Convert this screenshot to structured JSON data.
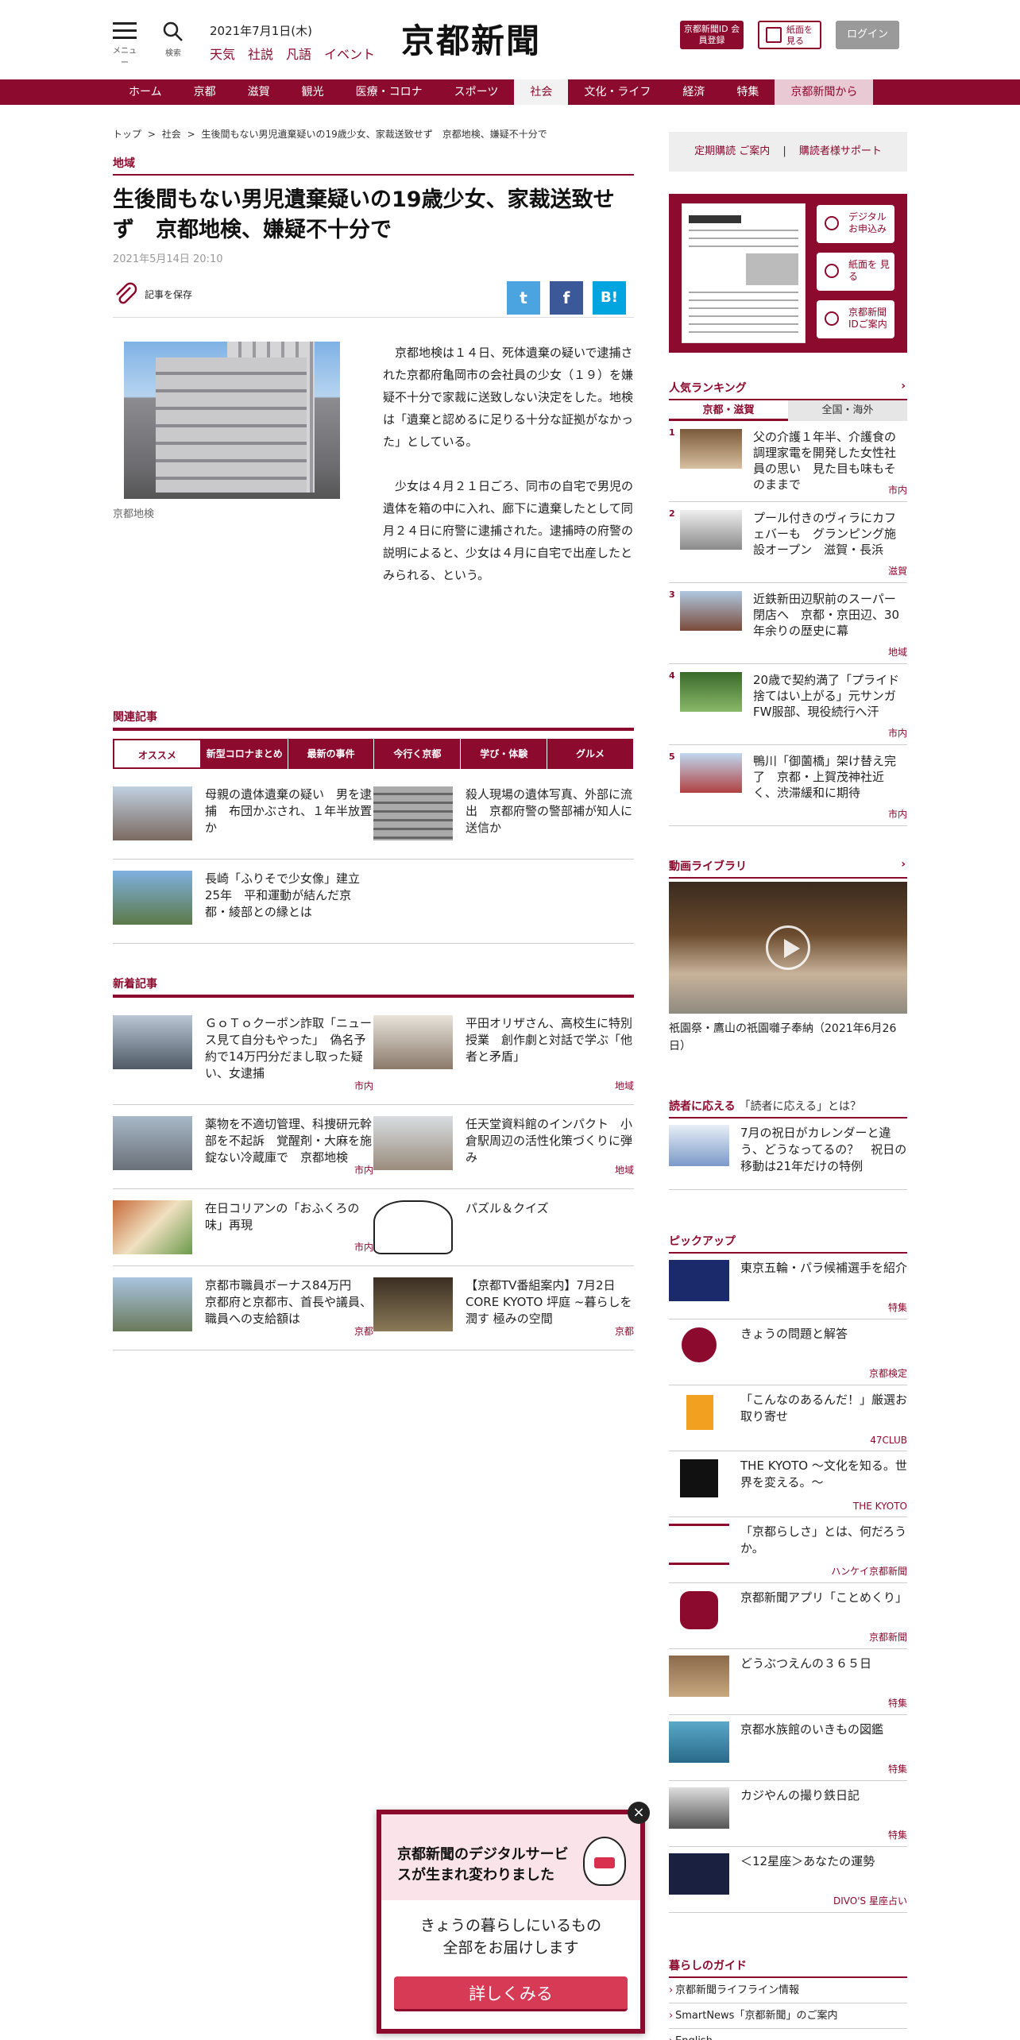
{
  "header": {
    "menu_label": "メニュー",
    "search_label": "検索",
    "date": "2021年7月1日(木)",
    "quick_links": [
      "天気",
      "社説",
      "凡語",
      "イベント"
    ],
    "logo": "京都新聞",
    "id_button": "京都新聞ID 会員登録",
    "paper_button": "紙面を見る",
    "login_button": "ログイン"
  },
  "nav": [
    "ホーム",
    "京都",
    "滋賀",
    "観光",
    "医療・コロナ",
    "スポーツ",
    "社会",
    "文化・ライフ",
    "経済",
    "特集",
    "京都新聞から"
  ],
  "breadcrumb": [
    "トップ",
    ">",
    "社会",
    ">",
    "生後間もない男児遺棄疑いの19歳少女、家裁送致せず　京都地検、嫌疑不十分で"
  ],
  "article": {
    "category": "地域",
    "title": "生後間もない男児遺棄疑いの19歳少女、家裁送致せず　京都地検、嫌疑不十分で",
    "date": "2021年5月14日 20:10",
    "save_label": "記事を保存",
    "share": {
      "twitter": "t",
      "facebook": "f",
      "hatena": "B!"
    },
    "photo_caption": "京都地検",
    "paragraphs": [
      "京都地検は１４日、死体遺棄の疑いで逮捕された京都府亀岡市の会社員の少女（１９）を嫌疑不十分で家裁に送致しない決定をした。地検は「遺棄と認めるに足りる十分な証拠がなかった」としている。",
      "少女は４月２１日ごろ、同市の自宅で男児の遺体を箱の中に入れ、廊下に遺棄したとして同月２４日に府警に逮捕された。逮捕時の府警の説明によると、少女は４月に自宅で出産したとみられる、という。"
    ]
  },
  "related": {
    "title": "関連記事",
    "tabs": [
      "オススメ",
      "新型コロナまとめ",
      "最新の事件",
      "今行く京都",
      "学び・体験",
      "グルメ"
    ],
    "items": [
      {
        "text": "母親の遺体遺棄の疑い　男を逮捕　布団かぶされ、１年半放置か"
      },
      {
        "text": "殺人現場の遺体写真、外部に流出　京都府警の警部補が知人に送信か"
      },
      {
        "text": "長崎「ふりそで少女像」建立25年　平和運動が結んだ京都・綾部との縁とは"
      }
    ]
  },
  "newest": {
    "title": "新着記事",
    "items": [
      {
        "text": "ＧｏＴｏクーポン詐取「ニュース見て自分もやった」　偽名予約で14万円分だまし取った疑い、女逮捕",
        "tag": "市内"
      },
      {
        "text": "平田オリザさん、高校生に特別授業　創作劇と対話で学ぶ「他者と矛盾」",
        "tag": "地域"
      },
      {
        "text": "薬物を不適切管理、科捜研元幹部を不起訴　覚醒剤・大麻を施錠ない冷蔵庫で　京都地検",
        "tag": "市内"
      },
      {
        "text": "任天堂資料館のインパクト　小倉駅周辺の活性化策づくりに弾み",
        "tag": "地域"
      },
      {
        "text": "在日コリアンの「おふくろの味」再現",
        "tag": "市内"
      },
      {
        "text": "パズル＆クイズ",
        "tag": ""
      },
      {
        "text": "京都市職員ボーナス84万円　京都府と京都市、首長や議員、職員への支給額は",
        "tag": "京都"
      },
      {
        "text": "【京都TV番組案内】7月2日　CORE KYOTO 坪庭 ~暮らしを潤す 極みの空間",
        "tag": "京都"
      }
    ]
  },
  "sidebar": {
    "sub_links": [
      "定期購読 ご案内",
      "|",
      "購読者様サポート"
    ],
    "paper_buttons": [
      "デジタル お申込み",
      "紙面を 見る",
      "京都新聞 IDご案内"
    ],
    "ranking_title": "人気ランキング",
    "ranking_tabs": [
      "京都・滋賀",
      "全国・海外"
    ],
    "ranking": [
      {
        "no": "1",
        "text": "父の介護１年半、介護食の調理家電を開発した女性社員の思い　見た目も味もそのままで",
        "tag": "市内"
      },
      {
        "no": "2",
        "text": "プール付きのヴィラにカフェバーも　グランピング施設オープン　滋賀・長浜",
        "tag": "滋賀"
      },
      {
        "no": "3",
        "text": "近鉄新田辺駅前のスーパー閉店へ　京都・京田辺、30年余りの歴史に幕",
        "tag": "地域"
      },
      {
        "no": "4",
        "text": "20歳で契約満了「プライド捨てはい上がる」元サンガFW服部、現役続行へ汗",
        "tag": "市内"
      },
      {
        "no": "5",
        "text": "鴨川「御薗橋」架け替え完了　京都・上賀茂神社近く、渋滞緩和に期待",
        "tag": "市内"
      }
    ],
    "video_title": "動画ライブラリ",
    "video_caption": "祇園祭・鷹山の祇園囃子奉納（2021年6月26日）",
    "reader_title_a": "読者に応える",
    "reader_title_b": "「読者に応える」とは？",
    "reader_item": "7月の祝日がカレンダーと違う、どうなってるの？　祝日の移動は21年だけの特例",
    "pickup_title": "ピックアップ",
    "pickup": [
      {
        "text": "東京五輪・パラ候補選手を紹介",
        "tag": "特集"
      },
      {
        "text": "きょうの問題と解答",
        "tag": "京都検定"
      },
      {
        "text": "「こんなのあるんだ！」厳選お取り寄せ",
        "tag": "47CLUB"
      },
      {
        "text": "THE KYOTO ～文化を知る。世界を変える。～",
        "tag": "THE KYOTO"
      },
      {
        "text": "「京都らしさ」とは、何だろうか。",
        "tag": "ハンケイ京都新聞"
      },
      {
        "text": "京都新聞アプリ「ことめくり」",
        "tag": "京都新聞"
      },
      {
        "text": "どうぶつえんの３６５日",
        "tag": "特集"
      },
      {
        "text": "京都水族館のいきもの図鑑",
        "tag": "特集"
      },
      {
        "text": "カジやんの撮り鉄日記",
        "tag": "特集"
      },
      {
        "text": "＜12星座＞あなたの運勢",
        "tag": "DIVO'S 星座占い"
      }
    ],
    "guide_title": "暮らしのガイド",
    "guide": [
      "京都新聞ライフライン情報",
      "SmartNews「京都新聞」のご案内",
      "English"
    ]
  },
  "promo": {
    "headline": "京都新聞のデジタルサービスが生まれ変わりました",
    "line1": "きょうの暮らしにいるもの",
    "line2": "全部をお届けします",
    "button": "詳しくみる",
    "close": "×"
  },
  "colors": {
    "brand": "#8c0a2e",
    "twitter": "#4ba3e0",
    "facebook": "#3b5998",
    "hatena": "#00a4de",
    "cta": "#d73a55"
  }
}
